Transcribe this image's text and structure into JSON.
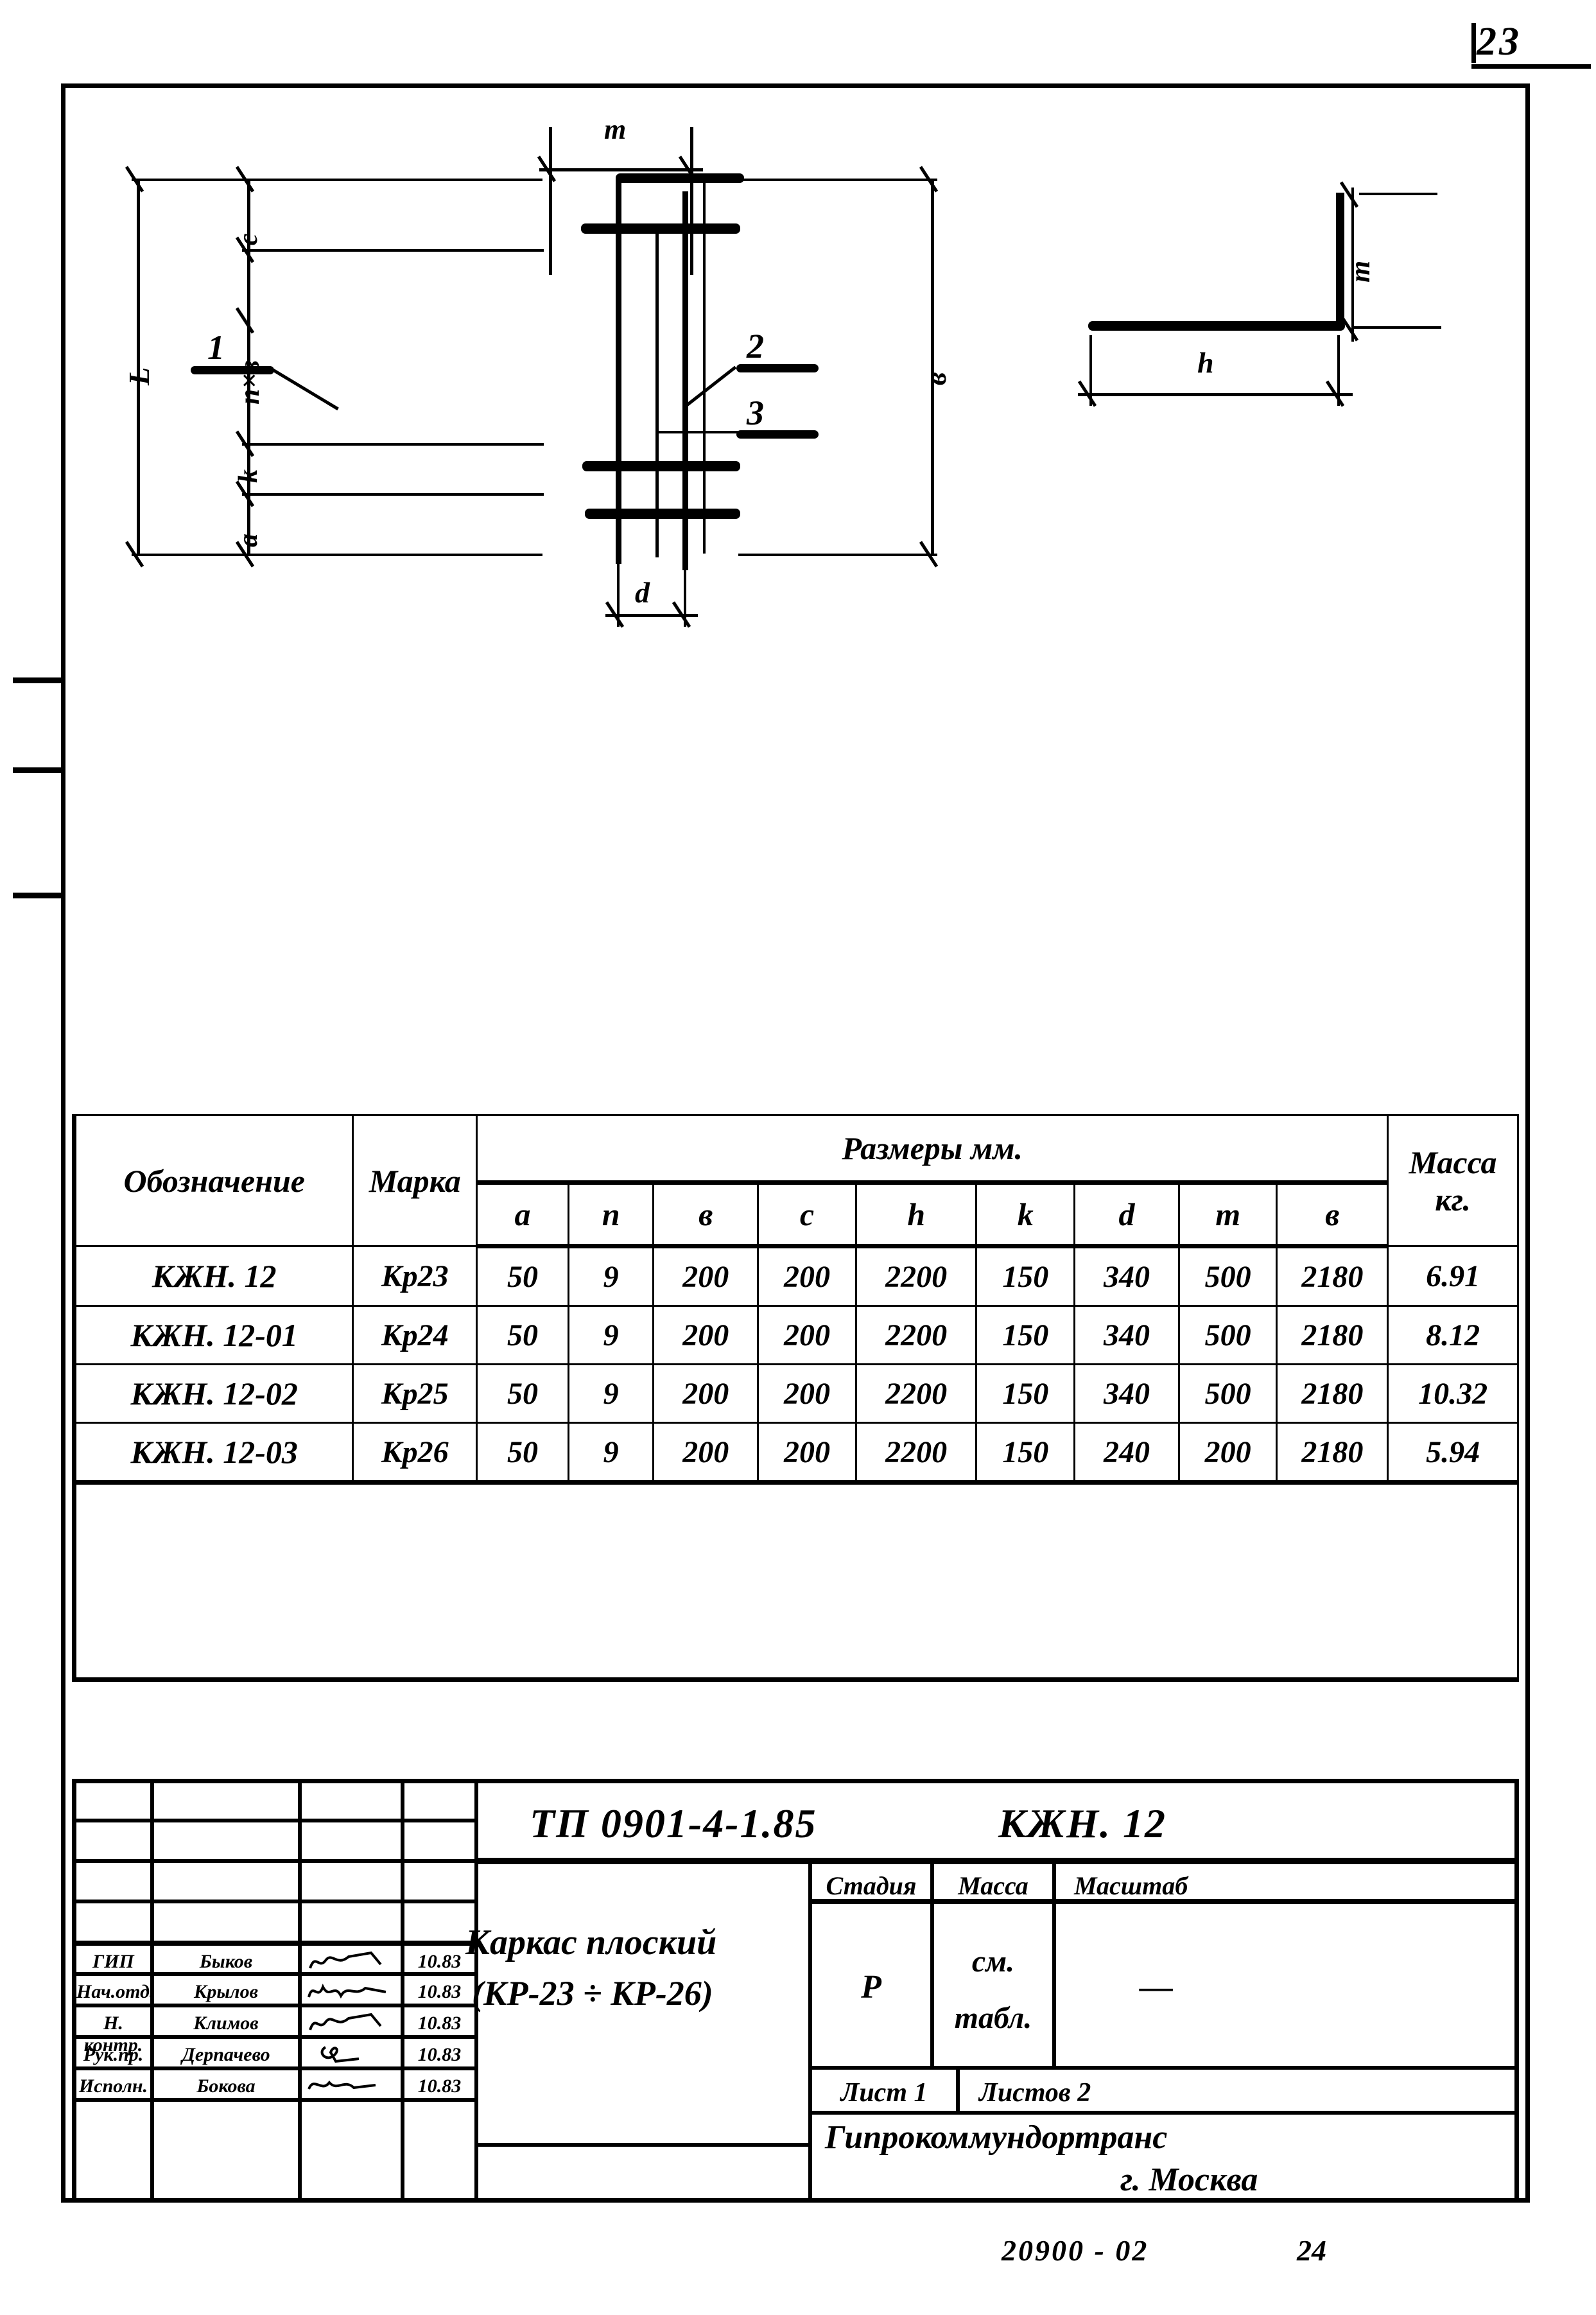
{
  "page": {
    "number": "23",
    "footer_code": "20900 - 02",
    "footer_sheet": "24"
  },
  "drawing": {
    "dimensions": {
      "overall_length": "L",
      "top_cover": "c",
      "spacing": "n×в",
      "bottom_k": "k",
      "bottom_a": "a",
      "width_b": "в",
      "bottom_d": "d",
      "top_m": "m",
      "detail_h": "h",
      "detail_m": "m"
    },
    "callouts": [
      "1",
      "2",
      "3"
    ]
  },
  "table": {
    "col_designation": "Обозначение",
    "col_mark": "Марка",
    "group_dimensions": "Размеры  мм.",
    "col_mass": "Масса",
    "col_mass_unit": "кг.",
    "dim_headers": [
      "a",
      "n",
      "в",
      "c",
      "h",
      "k",
      "d",
      "m",
      "в"
    ],
    "rows": [
      {
        "designation": "КЖН.  12",
        "mark": "Кр23",
        "dims": [
          "50",
          "9",
          "200",
          "200",
          "2200",
          "150",
          "340",
          "500",
          "2180"
        ],
        "mass": "6.91"
      },
      {
        "designation": "КЖН.  12-01",
        "mark": "Кр24",
        "dims": [
          "50",
          "9",
          "200",
          "200",
          "2200",
          "150",
          "340",
          "500",
          "2180"
        ],
        "mass": "8.12"
      },
      {
        "designation": "КЖН.  12-02",
        "mark": "Кр25",
        "dims": [
          "50",
          "9",
          "200",
          "200",
          "2200",
          "150",
          "340",
          "500",
          "2180"
        ],
        "mass": "10.32"
      },
      {
        "designation": "КЖН.  12-03",
        "mark": "Кр26",
        "dims": [
          "50",
          "9",
          "200",
          "200",
          "2200",
          "150",
          "240",
          "200",
          "2180"
        ],
        "mass": "5.94"
      }
    ]
  },
  "title_block": {
    "doc_code": "ТП 0901-4-1.85",
    "doc_mark": "КЖН. 12",
    "title_line1": "Каркас  плоский",
    "title_line2": "(КР-23 ÷ КР-26)",
    "stage_label": "Стадия",
    "mass_label": "Масса",
    "scale_label": "Масштаб",
    "stage_value": "Р",
    "mass_value_line1": "см.",
    "mass_value_line2": "табл.",
    "scale_value": "—",
    "sheet_label": "Лист 1",
    "sheets_label": "Листов 2",
    "org_name": "Гипрокоммундортранс",
    "org_city": "г. Москва",
    "signatures": [
      {
        "role": "ГИП",
        "name": "Быков",
        "date": "10.83"
      },
      {
        "role": "Нач.отд.",
        "name": "Крылов",
        "date": "10.83"
      },
      {
        "role": "Н. контр.",
        "name": "Климов",
        "date": "10.83"
      },
      {
        "role": "Рук.пр.",
        "name": "Дерпачево",
        "date": "10.83"
      },
      {
        "role": "Исполн.",
        "name": "Бокова",
        "date": "10.83"
      }
    ]
  }
}
